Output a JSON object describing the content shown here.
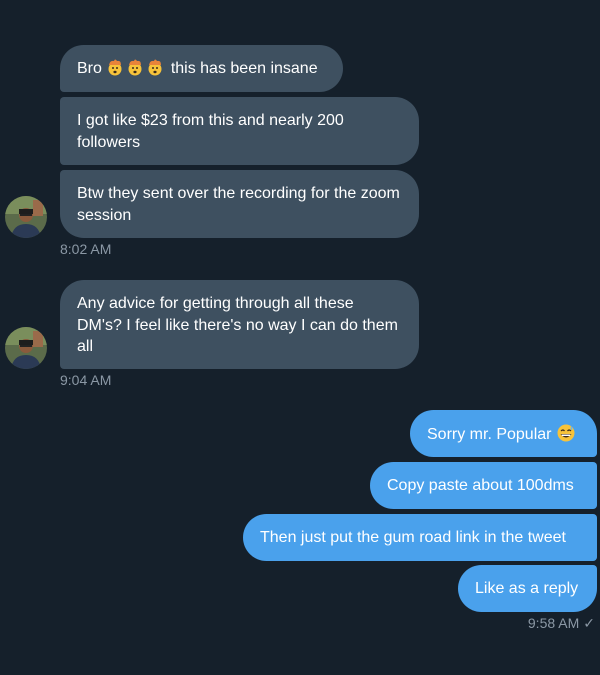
{
  "conversation": {
    "incoming": [
      {
        "bro_prefix": "Bro",
        "bro_emojis": [
          "exploding-head-emoji",
          "exploding-head-emoji",
          "exploding-head-emoji"
        ],
        "bro_suffix": "this has been insane",
        "msg2": "I got like $23 from this and nearly 200 followers",
        "msg3": "Btw they sent over the recording for the zoom session",
        "time": "8:02 AM"
      },
      {
        "msg1": "Any advice for getting through all these DM's? I feel like there's no way I can do them all",
        "time": "9:04 AM"
      }
    ],
    "outgoing": {
      "msg1_text": "Sorry mr. Popular",
      "msg1_emoji": "grinning-sweat-emoji",
      "msg2": "Copy paste about 100dms",
      "msg3": "Then just put the gum road link in the tweet",
      "msg4": "Like as a reply",
      "time": "9:58 AM",
      "status_icon": "check-icon",
      "status_glyph": "✓"
    }
  },
  "colors": {
    "background": "#15202b",
    "incoming_bubble": "#3e5060",
    "outgoing_bubble": "#4aa1ec",
    "timestamp": "#8b98a5"
  }
}
